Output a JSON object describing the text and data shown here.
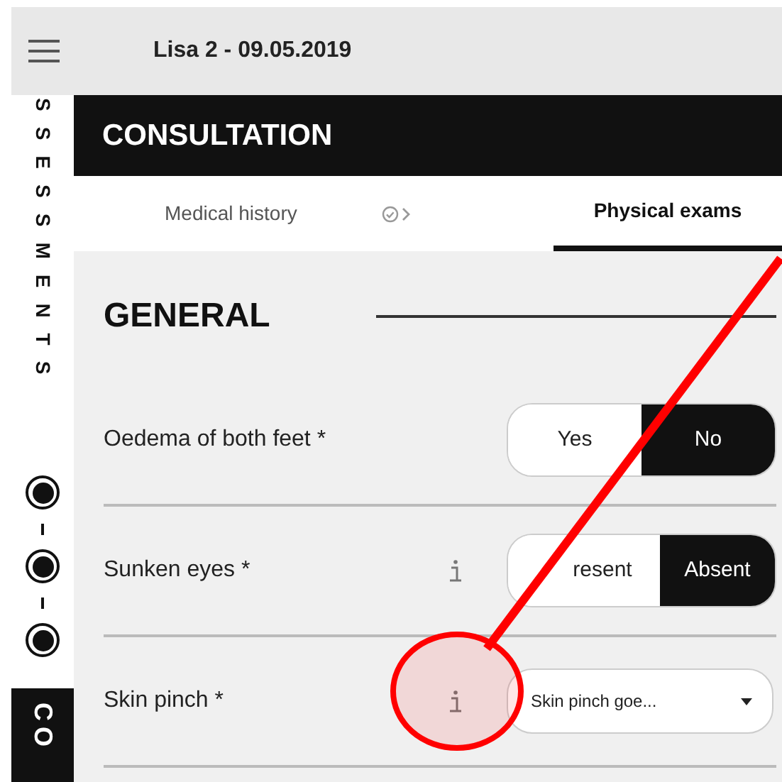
{
  "top_bar": {
    "title": "Lisa 2 - 09.05.2019"
  },
  "sidebar": {
    "label": "SSESSMENTS",
    "steps": [
      {
        "selected": true
      },
      {
        "selected": true
      },
      {
        "selected": true
      }
    ],
    "next_label": "CO"
  },
  "header": {
    "title": "CONSULTATION"
  },
  "tabs": [
    {
      "label": "Medical history",
      "selected": false,
      "done": true
    },
    {
      "label": "Physical exams",
      "selected": true,
      "done": false
    }
  ],
  "section": {
    "title": "GENERAL"
  },
  "questions": [
    {
      "kind": "toggle",
      "label": "Oedema of both feet *",
      "info": false,
      "options": [
        {
          "label": "Yes",
          "selected": false
        },
        {
          "label": "No",
          "selected": true
        }
      ]
    },
    {
      "kind": "toggle",
      "label": "Sunken eyes *",
      "info": true,
      "options": [
        {
          "label": "resent",
          "selected": false
        },
        {
          "label": "Absent",
          "selected": true
        }
      ]
    },
    {
      "kind": "dropdown",
      "label": "Skin pinch *",
      "info": true,
      "value": "Skin pinch goe..."
    }
  ]
}
